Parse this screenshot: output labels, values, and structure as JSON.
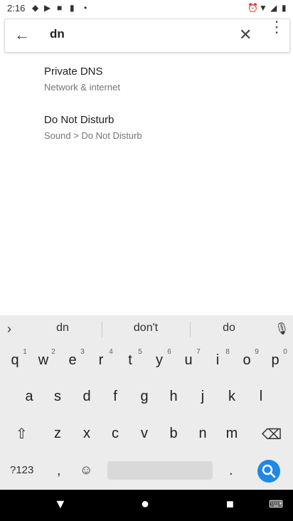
{
  "status": {
    "time": "2:16"
  },
  "search": {
    "query": "dn"
  },
  "results": [
    {
      "title": "Private DNS",
      "subtitle": "Network & internet"
    },
    {
      "title": "Do Not Disturb",
      "subtitle": "Sound > Do Not Disturb"
    }
  ],
  "suggestions": [
    "dn",
    "don't",
    "do"
  ],
  "keyboard": {
    "row1": [
      "q",
      "w",
      "e",
      "r",
      "t",
      "y",
      "u",
      "i",
      "o",
      "p"
    ],
    "row1_hints": [
      "1",
      "2",
      "3",
      "4",
      "5",
      "6",
      "7",
      "8",
      "9",
      "0"
    ],
    "row2": [
      "a",
      "s",
      "d",
      "f",
      "g",
      "h",
      "j",
      "k",
      "l"
    ],
    "row3": [
      "z",
      "x",
      "c",
      "v",
      "b",
      "n",
      "m"
    ],
    "symbols_label": "?123",
    "comma": ",",
    "period": "."
  },
  "colors": {
    "accent": "#1e88e5",
    "keyboard_bg": "#ececec"
  }
}
